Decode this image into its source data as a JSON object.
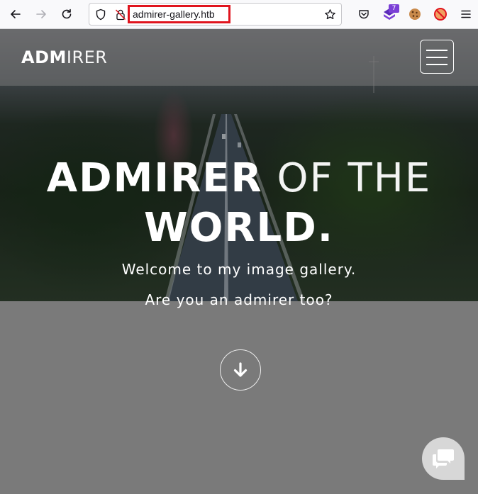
{
  "browser": {
    "url": "admirer-gallery.htb",
    "extension_badge": "7",
    "icons": [
      "back-arrow-icon",
      "forward-arrow-icon",
      "reload-icon",
      "shield-icon",
      "insecure-lock-icon",
      "bookmark-star-icon",
      "pocket-icon",
      "extension-icon",
      "cookie-icon",
      "blocked-icon",
      "hamburger-menu-icon"
    ]
  },
  "site": {
    "brand_bold": "ADM",
    "brand_light": "IRER",
    "hero_line1_bold": "ADMIRER",
    "hero_line1_light": "OF THE",
    "hero_line2": "WORLD.",
    "subtitle": "Welcome to my image gallery.",
    "tagline": "Are you an admirer too?"
  },
  "colors": {
    "url_highlight": "#e0141e",
    "badge": "#7b3fd6",
    "page_bg": "#7a7a7a"
  }
}
